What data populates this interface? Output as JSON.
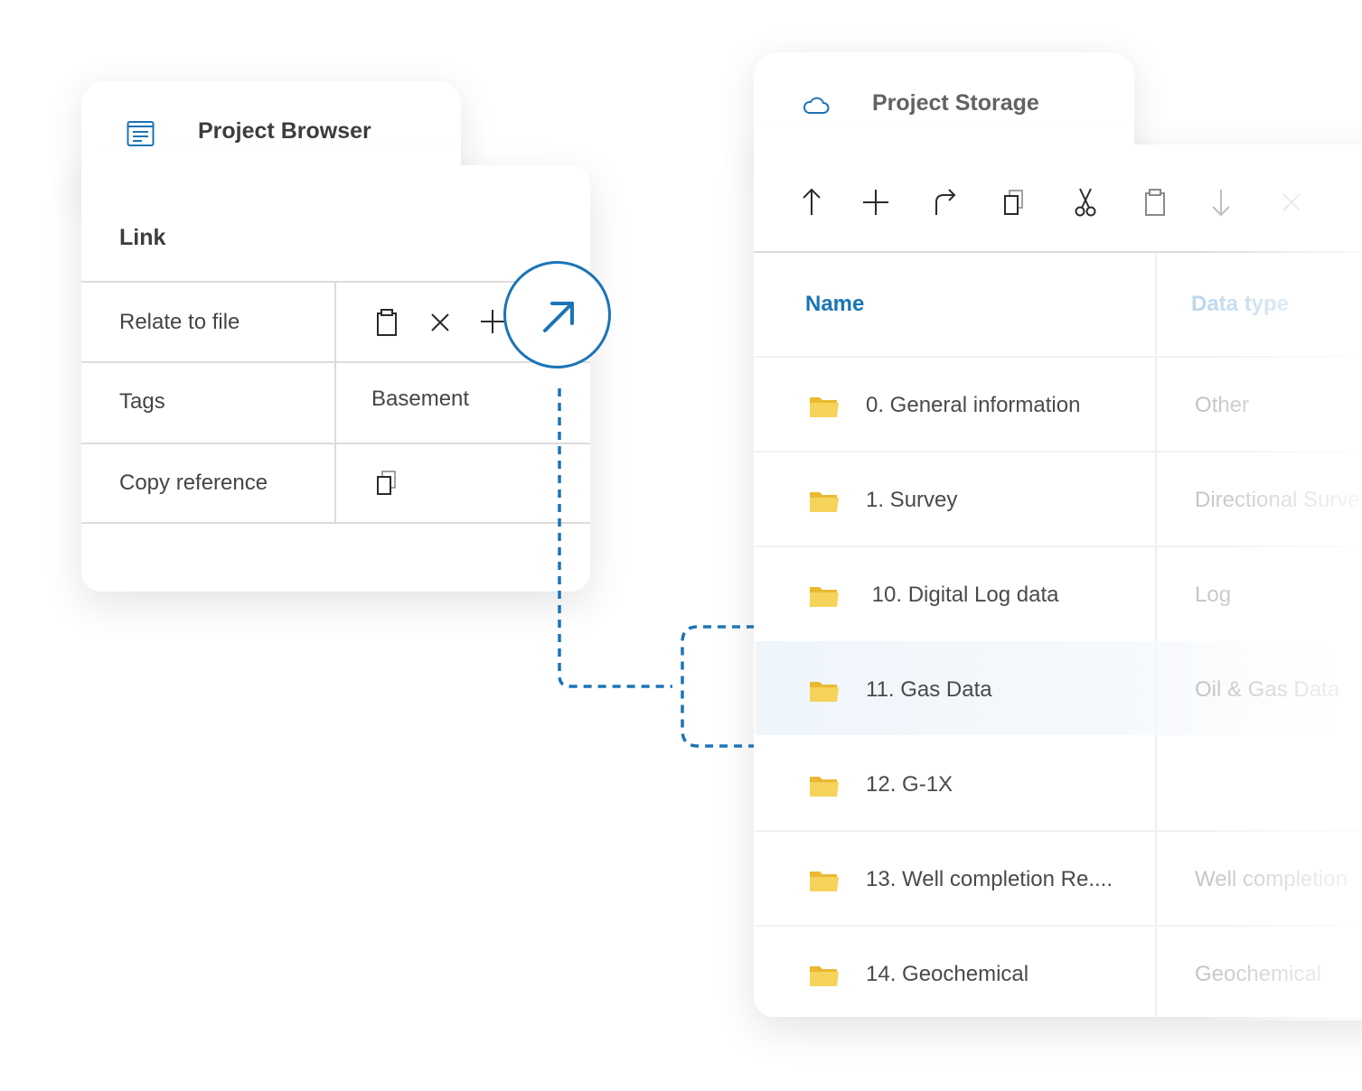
{
  "project_browser": {
    "title": "Project Browser",
    "icon": "document-list-icon",
    "section_label": "Link",
    "rows": [
      {
        "label": "Relate to file",
        "actions": [
          "paste-icon",
          "close-icon",
          "plus-icon"
        ]
      },
      {
        "label": "Tags",
        "value": "Basement"
      },
      {
        "label": "Copy reference",
        "actions": [
          "copy-icon"
        ]
      }
    ],
    "link_button_icon": "arrow-up-right-icon"
  },
  "project_storage": {
    "title": "Project Storage",
    "icon": "cloud-icon",
    "toolbar": [
      "arrow-up-icon",
      "plus-icon",
      "redo-arrow-icon",
      "copy-icon",
      "scissors-icon",
      "paste-icon",
      "arrow-down-icon",
      "close-icon"
    ],
    "columns": {
      "name": "Name",
      "data_type": "Data type"
    },
    "rows": [
      {
        "name": "0. General information",
        "data_type": "Other"
      },
      {
        "name": "1. Survey",
        "data_type": "Directional Surve"
      },
      {
        "name": " 10. Digital Log data",
        "data_type": "Log"
      },
      {
        "name": "11. Gas Data",
        "data_type": "Oil & Gas Data",
        "highlighted": true
      },
      {
        "name": "12. G-1X",
        "data_type": ""
      },
      {
        "name": "13. Well completion Re....",
        "data_type": "Well completion"
      },
      {
        "name": "14. Geochemical",
        "data_type": "Geochemical"
      }
    ]
  },
  "colors": {
    "accent": "#1a74b6",
    "column_header_active": "#1a74b6",
    "column_header_inactive": "#bcd7ec",
    "folder": "#f2c94c",
    "highlight_row": "#eef5fb"
  }
}
